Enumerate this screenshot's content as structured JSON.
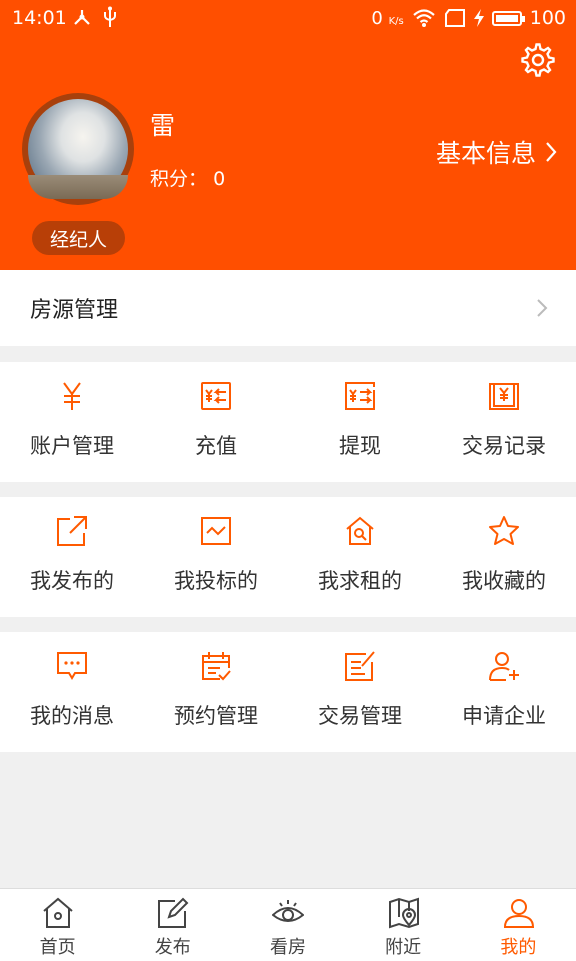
{
  "status_bar": {
    "time": "14:01",
    "network_speed": "0",
    "network_unit": "K/s",
    "battery": "100"
  },
  "profile": {
    "name": "雷",
    "points_label": "积分：",
    "points_value": "0",
    "role": "经纪人",
    "basic_info": "基本信息"
  },
  "listing_row": {
    "label": "房源管理"
  },
  "sections": [
    [
      {
        "label": "账户管理",
        "icon": "yuan-icon"
      },
      {
        "label": "充值",
        "icon": "recharge-icon"
      },
      {
        "label": "提现",
        "icon": "withdraw-icon"
      },
      {
        "label": "交易记录",
        "icon": "transaction-record-icon"
      }
    ],
    [
      {
        "label": "我发布的",
        "icon": "external-link-icon"
      },
      {
        "label": "我投标的",
        "icon": "trend-icon"
      },
      {
        "label": "我求租的",
        "icon": "house-search-icon"
      },
      {
        "label": "我收藏的",
        "icon": "star-icon"
      }
    ],
    [
      {
        "label": "我的消息",
        "icon": "message-icon"
      },
      {
        "label": "预约管理",
        "icon": "calendar-check-icon"
      },
      {
        "label": "交易管理",
        "icon": "edit-doc-icon"
      },
      {
        "label": "申请企业",
        "icon": "add-user-icon"
      }
    ]
  ],
  "bottom_nav": [
    {
      "label": "首页",
      "icon": "home-icon"
    },
    {
      "label": "发布",
      "icon": "publish-icon"
    },
    {
      "label": "看房",
      "icon": "eye-icon"
    },
    {
      "label": "附近",
      "icon": "map-icon"
    },
    {
      "label": "我的",
      "icon": "user-icon",
      "active": true
    }
  ],
  "colors": {
    "accent": "#ff4f00",
    "icon": "#ff5a00",
    "badge": "#b83f07"
  }
}
